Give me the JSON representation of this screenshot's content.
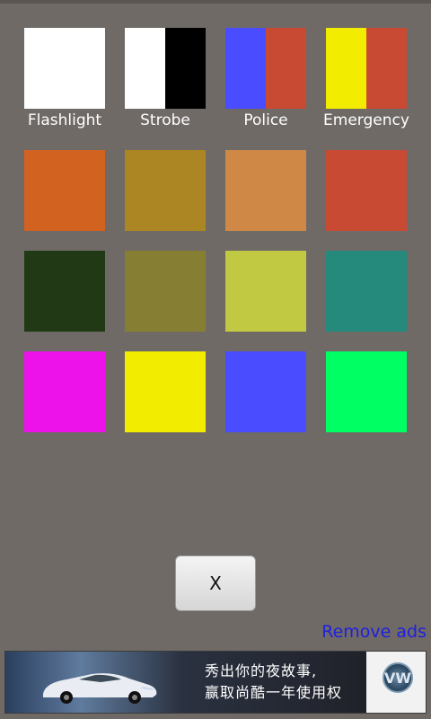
{
  "tiles": [
    {
      "label": "Flashlight",
      "colors": [
        "#ffffff"
      ]
    },
    {
      "label": "Strobe",
      "colors": [
        "#ffffff",
        "#000000"
      ]
    },
    {
      "label": "Police",
      "colors": [
        "#4a4cff",
        "#c94a33"
      ]
    },
    {
      "label": "Emergency",
      "colors": [
        "#f2ed00",
        "#c94a33"
      ]
    },
    {
      "colors": [
        "#d2621f"
      ]
    },
    {
      "colors": [
        "#ac8622"
      ]
    },
    {
      "colors": [
        "#cf8846"
      ]
    },
    {
      "colors": [
        "#c94a33"
      ]
    },
    {
      "colors": [
        "#213914"
      ]
    },
    {
      "colors": [
        "#867f33"
      ]
    },
    {
      "colors": [
        "#c1c842"
      ]
    },
    {
      "colors": [
        "#258a7b"
      ]
    },
    {
      "colors": [
        "#ee12ea"
      ]
    },
    {
      "colors": [
        "#f2ed00"
      ]
    },
    {
      "colors": [
        "#4a4cff"
      ]
    },
    {
      "colors": [
        "#00ff62"
      ]
    }
  ],
  "close_button": {
    "label": "X"
  },
  "remove_ads": {
    "label": "Remove ads"
  },
  "ad": {
    "line1": "秀出你的夜故事,",
    "line2": "赢取尚酷一年使用权",
    "logo": "VW"
  }
}
